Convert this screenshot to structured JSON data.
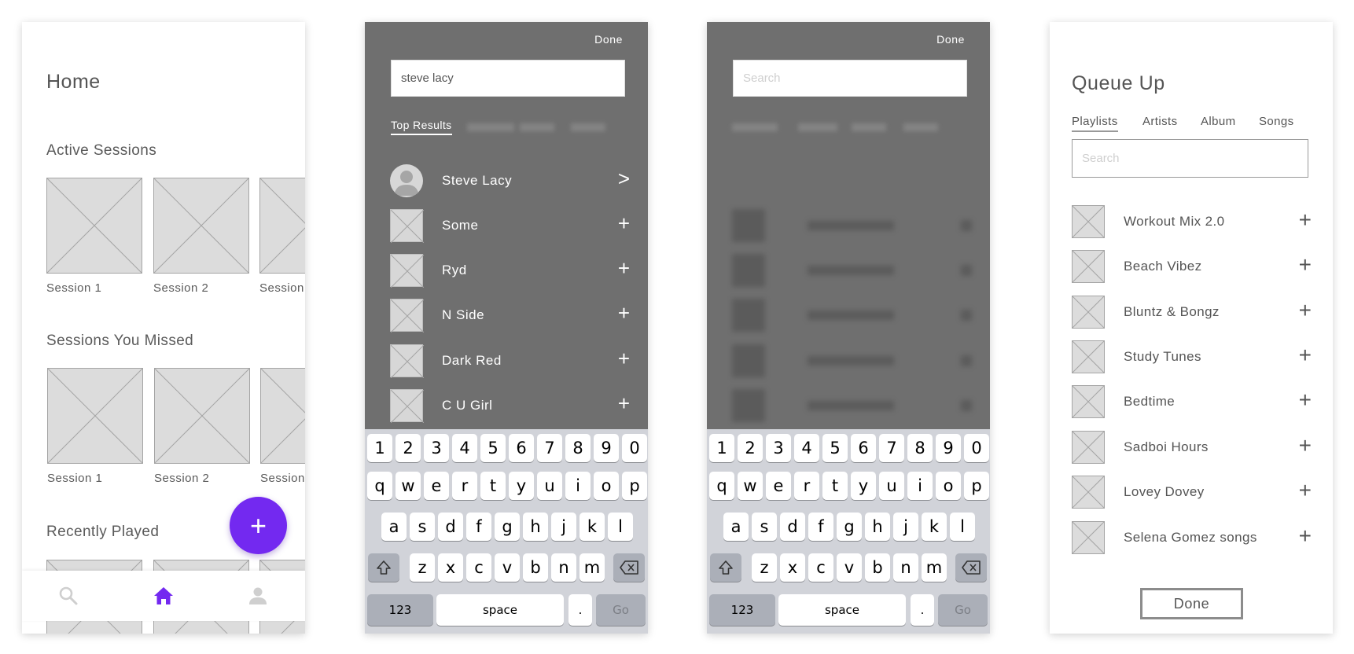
{
  "home": {
    "title": "Home",
    "active_sessions": {
      "heading": "Active Sessions",
      "items": [
        "Session 1",
        "Session 2",
        "Session"
      ]
    },
    "missed_sessions": {
      "heading": "Sessions You Missed",
      "items": [
        "Session 1",
        "Session 2",
        "Session"
      ]
    },
    "recently_played": {
      "heading": "Recently Played"
    },
    "fab_icon": "plus-icon",
    "nav": {
      "icons": [
        "search-icon",
        "home-icon",
        "profile-icon"
      ],
      "active": "home-icon",
      "active_color": "#7329f0"
    }
  },
  "search_results": {
    "done_label": "Done",
    "query": "steve lacy",
    "active_tab": "Top Results",
    "results": [
      {
        "label": "Steve Lacy",
        "kind": "artist",
        "action": ">"
      },
      {
        "label": "Some",
        "kind": "song",
        "action": "+"
      },
      {
        "label": "Ryd",
        "kind": "song",
        "action": "+"
      },
      {
        "label": "N Side",
        "kind": "song",
        "action": "+"
      },
      {
        "label": "Dark Red",
        "kind": "song",
        "action": "+"
      },
      {
        "label": "C U Girl",
        "kind": "song",
        "action": "+"
      }
    ]
  },
  "search_empty": {
    "done_label": "Done",
    "placeholder": "Search"
  },
  "keyboard": {
    "row1": [
      "1",
      "2",
      "3",
      "4",
      "5",
      "6",
      "7",
      "8",
      "9",
      "0"
    ],
    "row2": [
      "q",
      "w",
      "e",
      "r",
      "t",
      "y",
      "u",
      "i",
      "o",
      "p"
    ],
    "row3": [
      "a",
      "s",
      "d",
      "f",
      "g",
      "h",
      "j",
      "k",
      "l"
    ],
    "row4": [
      "z",
      "x",
      "c",
      "v",
      "b",
      "n",
      "m"
    ],
    "shift_icon": "shift-icon",
    "backspace_icon": "backspace-icon",
    "numbers_label": "123",
    "space_label": "space",
    "period_label": ".",
    "go_label": "Go"
  },
  "queue": {
    "title": "Queue Up",
    "tabs": [
      "Playlists",
      "Artists",
      "Album",
      "Songs"
    ],
    "active_tab": "Playlists",
    "search_placeholder": "Search",
    "playlists": [
      "Workout Mix 2.0",
      "Beach Vibez",
      "Bluntz & Bongz",
      "Study Tunes",
      "Bedtime",
      "Sadboi Hours",
      "Lovey Dovey",
      "Selena Gomez songs"
    ],
    "add_icon": "plus-icon",
    "done_label": "Done"
  }
}
